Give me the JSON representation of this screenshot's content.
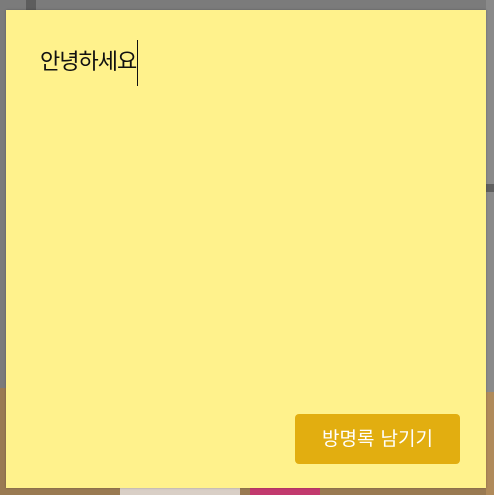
{
  "note": {
    "text": "안녕하세요",
    "background_color": "#fff28c"
  },
  "actions": {
    "submit_label": "방명록 남기기",
    "submit_color": "#e2ae10"
  }
}
